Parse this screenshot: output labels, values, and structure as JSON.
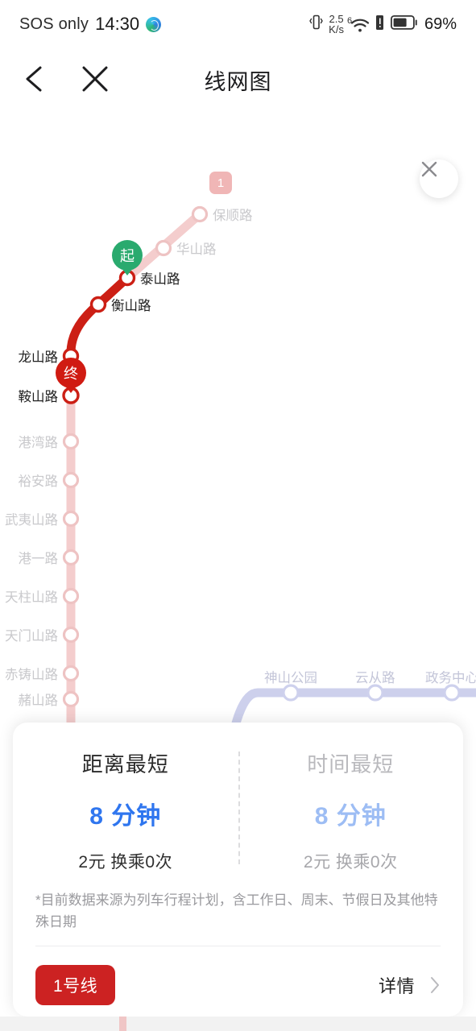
{
  "status_bar": {
    "carrier": "SOS only",
    "time": "14:30",
    "globe_icon": "globe-icon",
    "vibrate_icon": "vibrate-icon",
    "net_speed_value": "2.5",
    "net_speed_unit": "K/s",
    "wifi_icon": "wifi-icon",
    "wifi_generation": "6",
    "alert_icon": "alert-icon",
    "battery_icon": "battery-icon",
    "battery_text": "69%"
  },
  "nav_bar": {
    "back_icon": "chevron-left-icon",
    "close_icon": "close-icon",
    "title": "线网图"
  },
  "map": {
    "close_icon": "close-icon",
    "line_badge": "1",
    "start_marker": "起",
    "end_marker": "终",
    "colors": {
      "line1_active": "#cc1f15",
      "line1_dim": "#f2c2c2",
      "line2_dim": "#c6c9e6",
      "start": "#2aaa6e",
      "end": "#d01b12"
    },
    "line1_stations": [
      {
        "name": "保顺路",
        "state": "dim"
      },
      {
        "name": "华山路",
        "state": "dim"
      },
      {
        "name": "泰山路",
        "state": "active"
      },
      {
        "name": "衡山路",
        "state": "active"
      },
      {
        "name": "龙山路",
        "state": "active"
      },
      {
        "name": "鞍山路",
        "state": "active"
      },
      {
        "name": "港湾路",
        "state": "dim"
      },
      {
        "name": "裕安路",
        "state": "dim"
      },
      {
        "name": "武夷山路",
        "state": "dim"
      },
      {
        "name": "港一路",
        "state": "dim"
      },
      {
        "name": "天柱山路",
        "state": "dim"
      },
      {
        "name": "天门山路",
        "state": "dim"
      },
      {
        "name": "赤铸山路",
        "state": "dim"
      },
      {
        "name": "赭山路",
        "state": "dim"
      }
    ],
    "line2_stations": [
      {
        "name": "神山公园",
        "state": "dim"
      },
      {
        "name": "云从路",
        "state": "dim"
      },
      {
        "name": "政务中心",
        "state": "dim"
      }
    ]
  },
  "card": {
    "options": [
      {
        "title": "距离最短",
        "time": "8 分钟",
        "sub": "2元  换乘0次",
        "selected": true
      },
      {
        "title": "时间最短",
        "time": "8 分钟",
        "sub": "2元  换乘0次",
        "selected": false
      }
    ],
    "note": "*目前数据来源为列车行程计划，含工作日、周末、节假日及其他特殊日期",
    "line_pill": "1号线",
    "detail_label": "详情",
    "detail_icon": "chevron-right-icon"
  }
}
